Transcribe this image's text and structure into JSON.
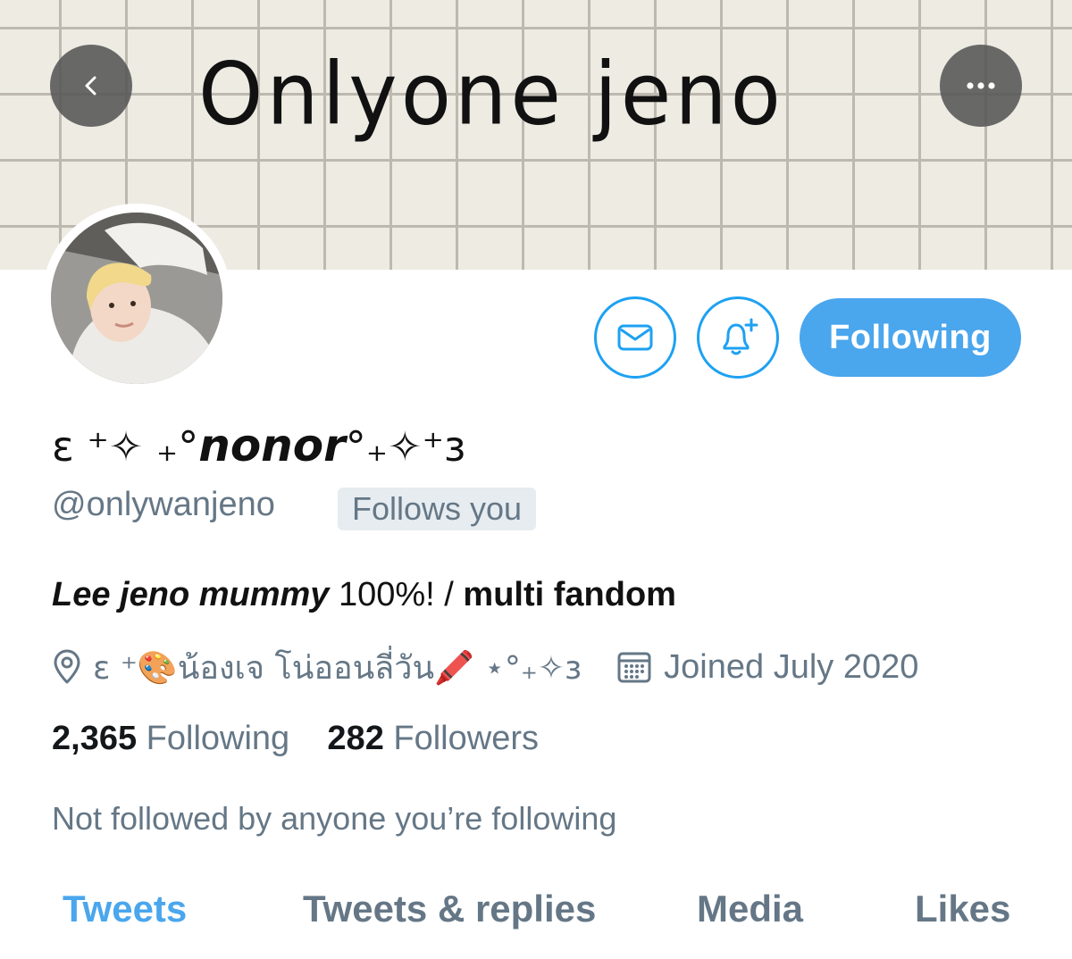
{
  "banner": {
    "title": "Onlyone jeno"
  },
  "actions": {
    "following_label": "Following"
  },
  "profile": {
    "name_prefix": "ε ⁺✧ ₊°",
    "name_main": "nonor",
    "name_suffix": "°₊✧⁺з",
    "handle": "@onlywanjeno",
    "follows_you": "Follows you",
    "bio_italic": "Lee jeno mummy",
    "bio_plain": " 100%! / ",
    "bio_bold": "multi fandom",
    "location": "ε ⁺🎨น้องเจ โน่ออนลี่วัน🖍️ ⋆°₊✧з",
    "joined": "Joined July 2020"
  },
  "stats": {
    "following_count": "2,365",
    "following_label": "Following",
    "followers_count": "282",
    "followers_label": "Followers"
  },
  "not_followed_text": "Not followed by anyone you’re following",
  "tabs": [
    {
      "label": "Tweets",
      "active": true
    },
    {
      "label": "Tweets & replies",
      "active": false
    },
    {
      "label": "Media",
      "active": false
    },
    {
      "label": "Likes",
      "active": false
    }
  ],
  "colors": {
    "accent": "#4aa6ed",
    "secondary_text": "#657786",
    "button_bg": "#555555"
  },
  "icons": [
    "back-arrow-icon",
    "more-dots-icon",
    "mail-icon",
    "bell-plus-icon",
    "location-pin-icon",
    "calendar-icon"
  ]
}
